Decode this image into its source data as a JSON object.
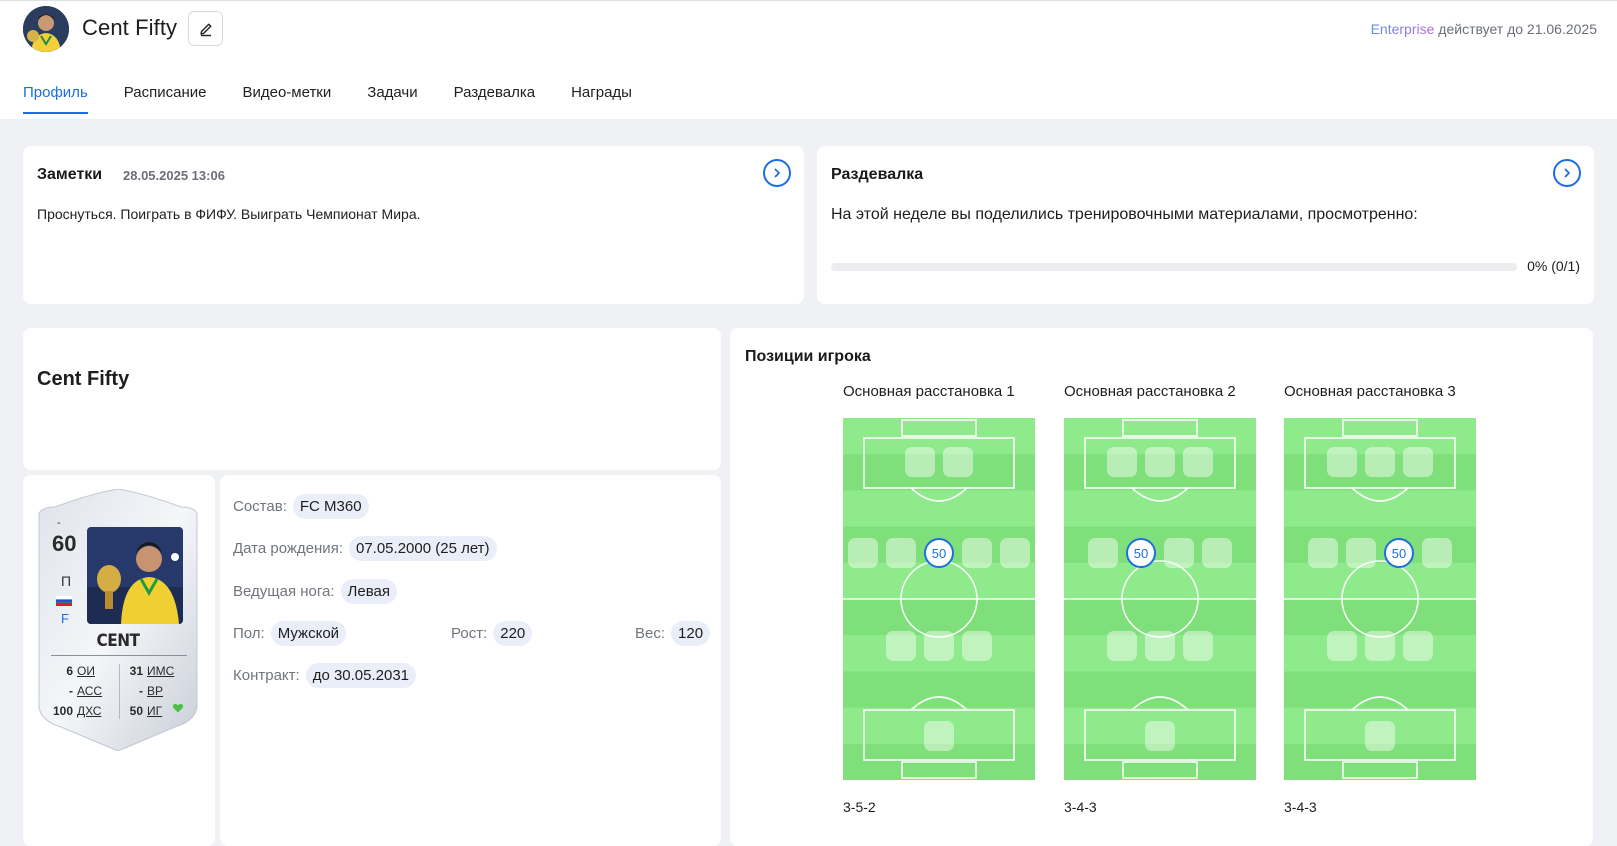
{
  "header": {
    "player_name": "Cent Fifty",
    "license_plan": "Enterprise",
    "license_text": "действует до 21.06.2025"
  },
  "tabs": [
    {
      "label": "Профиль",
      "active": true
    },
    {
      "label": "Расписание",
      "active": false
    },
    {
      "label": "Видео-метки",
      "active": false
    },
    {
      "label": "Задачи",
      "active": false
    },
    {
      "label": "Раздевалка",
      "active": false
    },
    {
      "label": "Награды",
      "active": false
    }
  ],
  "notes": {
    "title": "Заметки",
    "date": "28.05.2025 13:06",
    "text": "Проснуться. Поиграть в ФИФУ. Выиграть Чемпионат Мира."
  },
  "locker": {
    "title": "Раздевалка",
    "text": "На этой неделе вы поделились тренировочными материалами, просмотренно:",
    "progress_fraction": 0,
    "progress_label": "0% (0/1)"
  },
  "profile": {
    "name": "Cent Fifty"
  },
  "fut_card": {
    "top_dash": "-",
    "rating": "60",
    "position": "П",
    "foot": "F",
    "card_name": "CENT",
    "stats_left": [
      {
        "value": "6",
        "key": "ОИ"
      },
      {
        "value": "-",
        "key": "АСС"
      },
      {
        "value": "100",
        "key": "ДХС"
      }
    ],
    "stats_right": [
      {
        "value": "31",
        "key": "ИМС"
      },
      {
        "value": "-",
        "key": "ВР"
      },
      {
        "value": "50",
        "key": "ИГ"
      }
    ]
  },
  "info": {
    "squad_label": "Состав:",
    "squad_value": "FC M360",
    "birth_label": "Дата рождения:",
    "birth_value": "07.05.2000 (25 лет)",
    "foot_label": "Ведущая нога:",
    "foot_value": "Левая",
    "gender_label": "Пол:",
    "gender_value": "Мужской",
    "height_label": "Рост:",
    "height_value": "220",
    "weight_label": "Вес:",
    "weight_value": "120",
    "contract_label": "Контракт:",
    "contract_value": "до 30.05.2031"
  },
  "positions": {
    "title": "Позиции игрока",
    "formations": [
      {
        "title": "Основная расстановка 1",
        "scheme": "3-5-2",
        "badge": "50",
        "attack": 2,
        "mid": 5,
        "def": 3,
        "badge_index": 2
      },
      {
        "title": "Основная расстановка 2",
        "scheme": "3-4-3",
        "badge": "50",
        "attack": 3,
        "mid": 4,
        "def": 3,
        "badge_index": 1
      },
      {
        "title": "Основная расстановка 3",
        "scheme": "3-4-3",
        "badge": "50",
        "attack": 3,
        "mid": 4,
        "def": 3,
        "badge_index": 2
      }
    ]
  },
  "colors": {
    "accent": "#1b6fe0",
    "pitch_light": "#8eea8a",
    "pitch_dark": "#7fe07b",
    "chip_bg": "#eaeef8"
  }
}
